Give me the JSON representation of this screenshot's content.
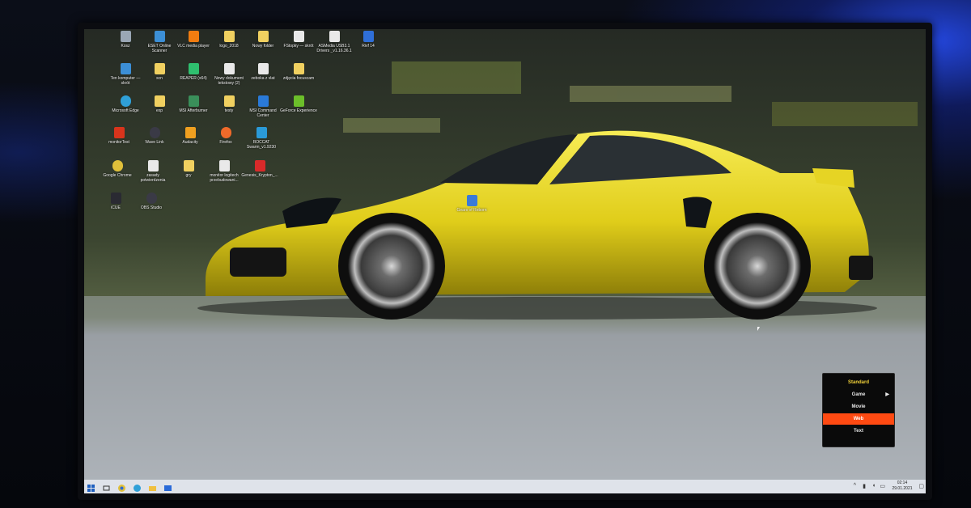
{
  "desktop": {
    "icons": [
      {
        "label": "Kosz",
        "color": "#9aa7b5"
      },
      {
        "label": "ESET Online Scanner",
        "color": "#3c8fd6"
      },
      {
        "label": "VLC media player",
        "color": "#f07c10"
      },
      {
        "label": "logo_2018",
        "color": "#f0d060"
      },
      {
        "label": "Nowy folder",
        "color": "#f0d060"
      },
      {
        "label": "FStopky — skrót",
        "color": "#e9e9e9"
      },
      {
        "label": "ASMedia USB3.1 Drivers _v1.16.36.1",
        "color": "#e9e9e9"
      },
      {
        "label": "Rivf 14",
        "color": "#2f6fd8"
      },
      {
        "label": "Ten komputer — skrót",
        "color": "#3c8fd6"
      },
      {
        "label": "scn",
        "color": "#f0d060"
      },
      {
        "label": "REAPER (x64)",
        "color": "#2fbf6f"
      },
      {
        "label": "Nowy dokument tekstowy (2)",
        "color": "#e9e9e9"
      },
      {
        "label": "zeboka z vlat",
        "color": "#e9e9e9"
      },
      {
        "label": "zdjęcia focuscam",
        "color": "#f0d060"
      },
      {
        "label": "Microsoft Edge",
        "color": "#2fa0d8"
      },
      {
        "label": "exp",
        "color": "#f0d060"
      },
      {
        "label": "MSI Afterburner",
        "color": "#3a8f5a"
      },
      {
        "label": "testy",
        "color": "#f0d060"
      },
      {
        "label": "MSI Command Center",
        "color": "#2a7ad8"
      },
      {
        "label": "GeForce Experience",
        "color": "#6cbf2a"
      },
      {
        "label": "monitorTest",
        "color": "#d8341c"
      },
      {
        "label": "Wave Link",
        "color": "#3a3a46"
      },
      {
        "label": "Audacity",
        "color": "#f0a020"
      },
      {
        "label": "Firefox",
        "color": "#f06a2a"
      },
      {
        "label": "ROCCAT Swarm_v1.9230",
        "color": "#2a9ad8"
      },
      {
        "label": "Google Chrome",
        "color": "#e0c03a"
      },
      {
        "label": "zasady potwierdzenia",
        "color": "#e9e9e9"
      },
      {
        "label": "gry",
        "color": "#f0d060"
      },
      {
        "label": "monitor logitech przebudowani...",
        "color": "#e9e9e9"
      },
      {
        "label": "Genesis_Krypton_...",
        "color": "#d82a2a"
      },
      {
        "label": "iCUE",
        "color": "#2a2a32"
      },
      {
        "label": "OBS Studio",
        "color": "#3a3a46"
      },
      {
        "label": "Gears of Reborn",
        "color": "#3a7ad8"
      }
    ]
  },
  "osd_menu": {
    "items": [
      {
        "label": "Standard",
        "state": "header"
      },
      {
        "label": "Game",
        "state": "submenu"
      },
      {
        "label": "Movie",
        "state": "normal"
      },
      {
        "label": "Web",
        "state": "selected"
      },
      {
        "label": "Text",
        "state": "normal"
      }
    ],
    "submenu_arrow": "▶",
    "accent": "#ff4a12",
    "header_color": "#f2d23a"
  },
  "taskbar": {
    "start_icon": "windows-start-icon",
    "apps": [
      "task-view-icon",
      "chrome-icon",
      "edge-icon",
      "file-explorer-icon",
      "mail-icon"
    ],
    "clock_time": "02:14",
    "clock_date": "29.01.2021"
  }
}
